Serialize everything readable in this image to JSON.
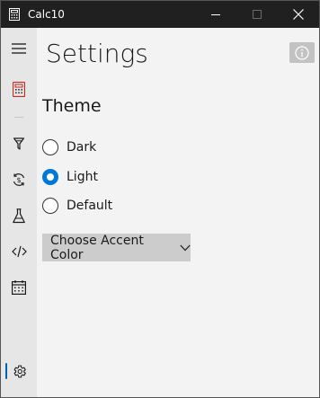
{
  "window": {
    "title": "Calc10",
    "controls": {
      "minimize": "minimize",
      "maximize": "maximize",
      "close": "close"
    }
  },
  "rail": {
    "items": [
      {
        "icon": "hamburger-menu-icon"
      },
      {
        "icon": "calculator-icon"
      },
      {
        "icon": "funnel-icon"
      },
      {
        "icon": "currency-convert-icon"
      },
      {
        "icon": "flask-icon"
      },
      {
        "icon": "code-icon"
      },
      {
        "icon": "calendar-icon"
      },
      {
        "icon": "gear-icon",
        "active": true
      }
    ]
  },
  "page": {
    "title": "Settings",
    "info_icon": "info-icon"
  },
  "theme": {
    "title": "Theme",
    "options": [
      {
        "label": "Dark",
        "checked": false
      },
      {
        "label": "Light",
        "checked": true
      },
      {
        "label": "Default",
        "checked": false
      }
    ]
  },
  "accent": {
    "label": "Choose Accent Color"
  },
  "colors": {
    "titlebar": "#202020",
    "rail": "#e6e6e6",
    "content": "#f3f3f3",
    "accent_blue": "#0078d7",
    "active_indicator": "#0063b1",
    "button_gray": "#cccccc"
  }
}
